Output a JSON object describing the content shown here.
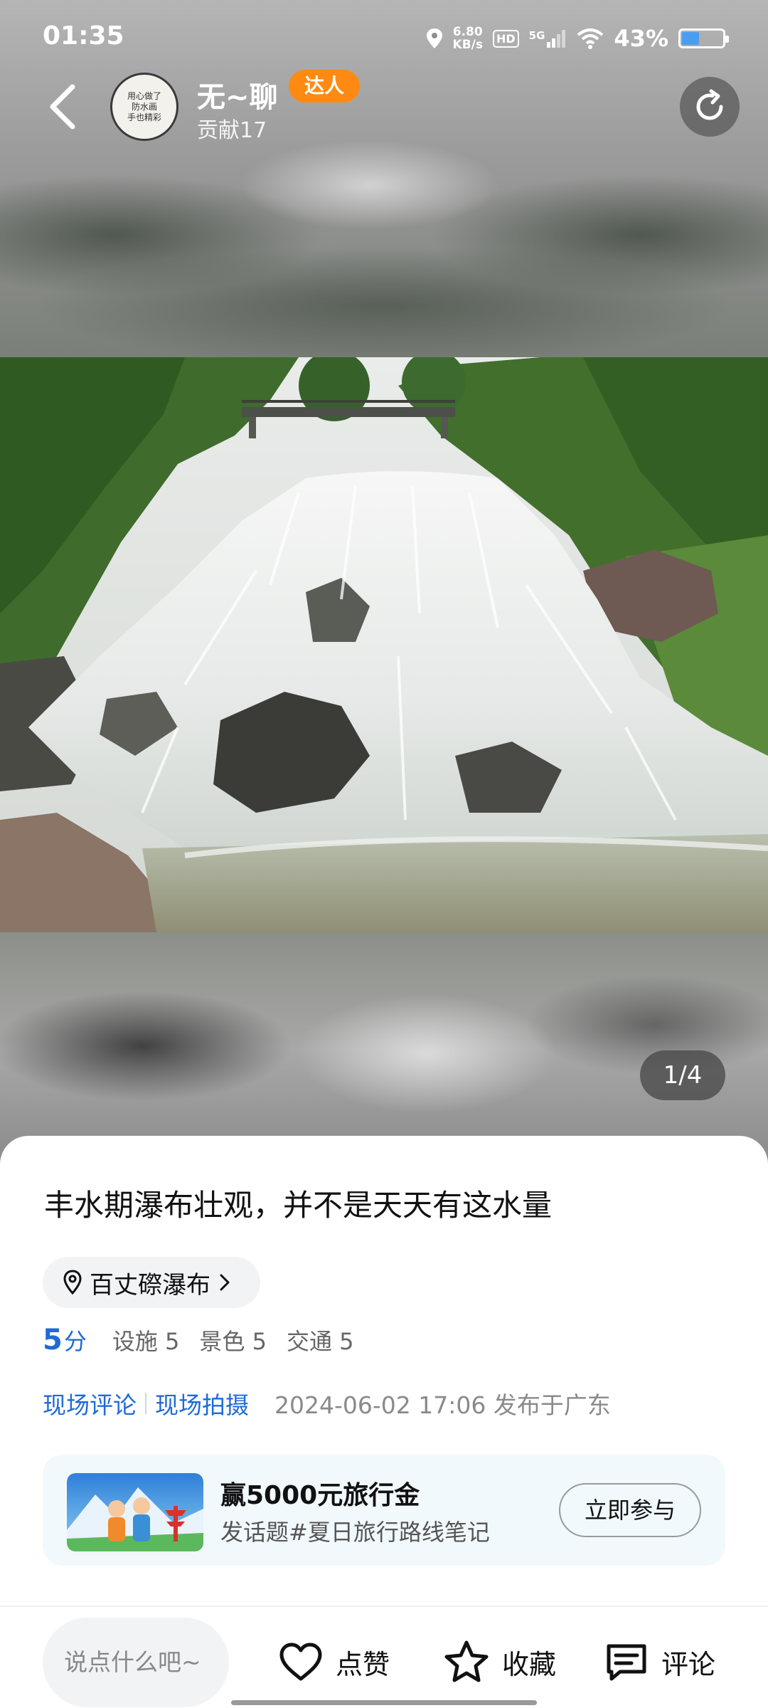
{
  "status_bar": {
    "time": "01:35",
    "net_speed_value": "6.80",
    "net_speed_unit": "KB/s",
    "hd": "HD",
    "signal": "5G",
    "battery_percent": "43%",
    "battery_level": 0.43
  },
  "header": {
    "user_name": "无~聊",
    "badge": "达人",
    "contribution": "贡献17",
    "avatar_text": [
      "用心做了",
      "防水画",
      "手也精彩"
    ]
  },
  "gallery": {
    "indicator": "1/4"
  },
  "post": {
    "title": "丰水期瀑布壮观，并不是天天有这水量",
    "location": "百丈磜瀑布",
    "score": "5",
    "score_unit": "分",
    "sub_scores": [
      "设施 5",
      "景色 5",
      "交通 5"
    ],
    "tags": [
      "现场评论",
      "现场拍摄"
    ],
    "publish_info": "2024-06-02 17:06 发布于广东"
  },
  "promo": {
    "title": "赢5000元旅行金",
    "subtitle": "发话题#夏日旅行路线笔记",
    "button": "立即参与"
  },
  "bottom_bar": {
    "comment_placeholder": "说点什么吧~",
    "like": "点赞",
    "favorite": "收藏",
    "comment": "评论"
  },
  "colors": {
    "accent_blue": "#1f6bd6",
    "badge_orange": "#ff8a12",
    "promo_bg": "#f1f9fd"
  }
}
